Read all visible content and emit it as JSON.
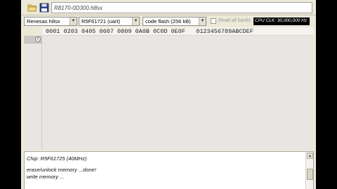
{
  "toolbar": {
    "open_icon": "folder-icon",
    "save_icon": "floppy-disk-icon",
    "file_path": "R8170-0D300.h8sx"
  },
  "options": {
    "vendor": "Renesas h8sx",
    "interface": "R5F61721 (uart)",
    "memory_region": "code flash (256 kB)",
    "read_all_banks_label": "Read all banks",
    "read_all_banks_checked": false,
    "cpu_clock": "CPU CLK: 30,000,000 Hz"
  },
  "hex_view": {
    "column_header": "0001 0203 0405 0607 0809 0A0B 0C0D 0E0F   0123456789ABCDEF",
    "row_marker_icon": "info-icon"
  },
  "log": {
    "lines": [
      "Chip: R5F61725 (40MHz)",
      "erase/unlock memory ...done!",
      "write memory ..."
    ]
  },
  "colors": {
    "window_bg": "#ece9d8",
    "hex_bg": "#e7e6e2",
    "cpu_clock_bg": "#000000"
  }
}
